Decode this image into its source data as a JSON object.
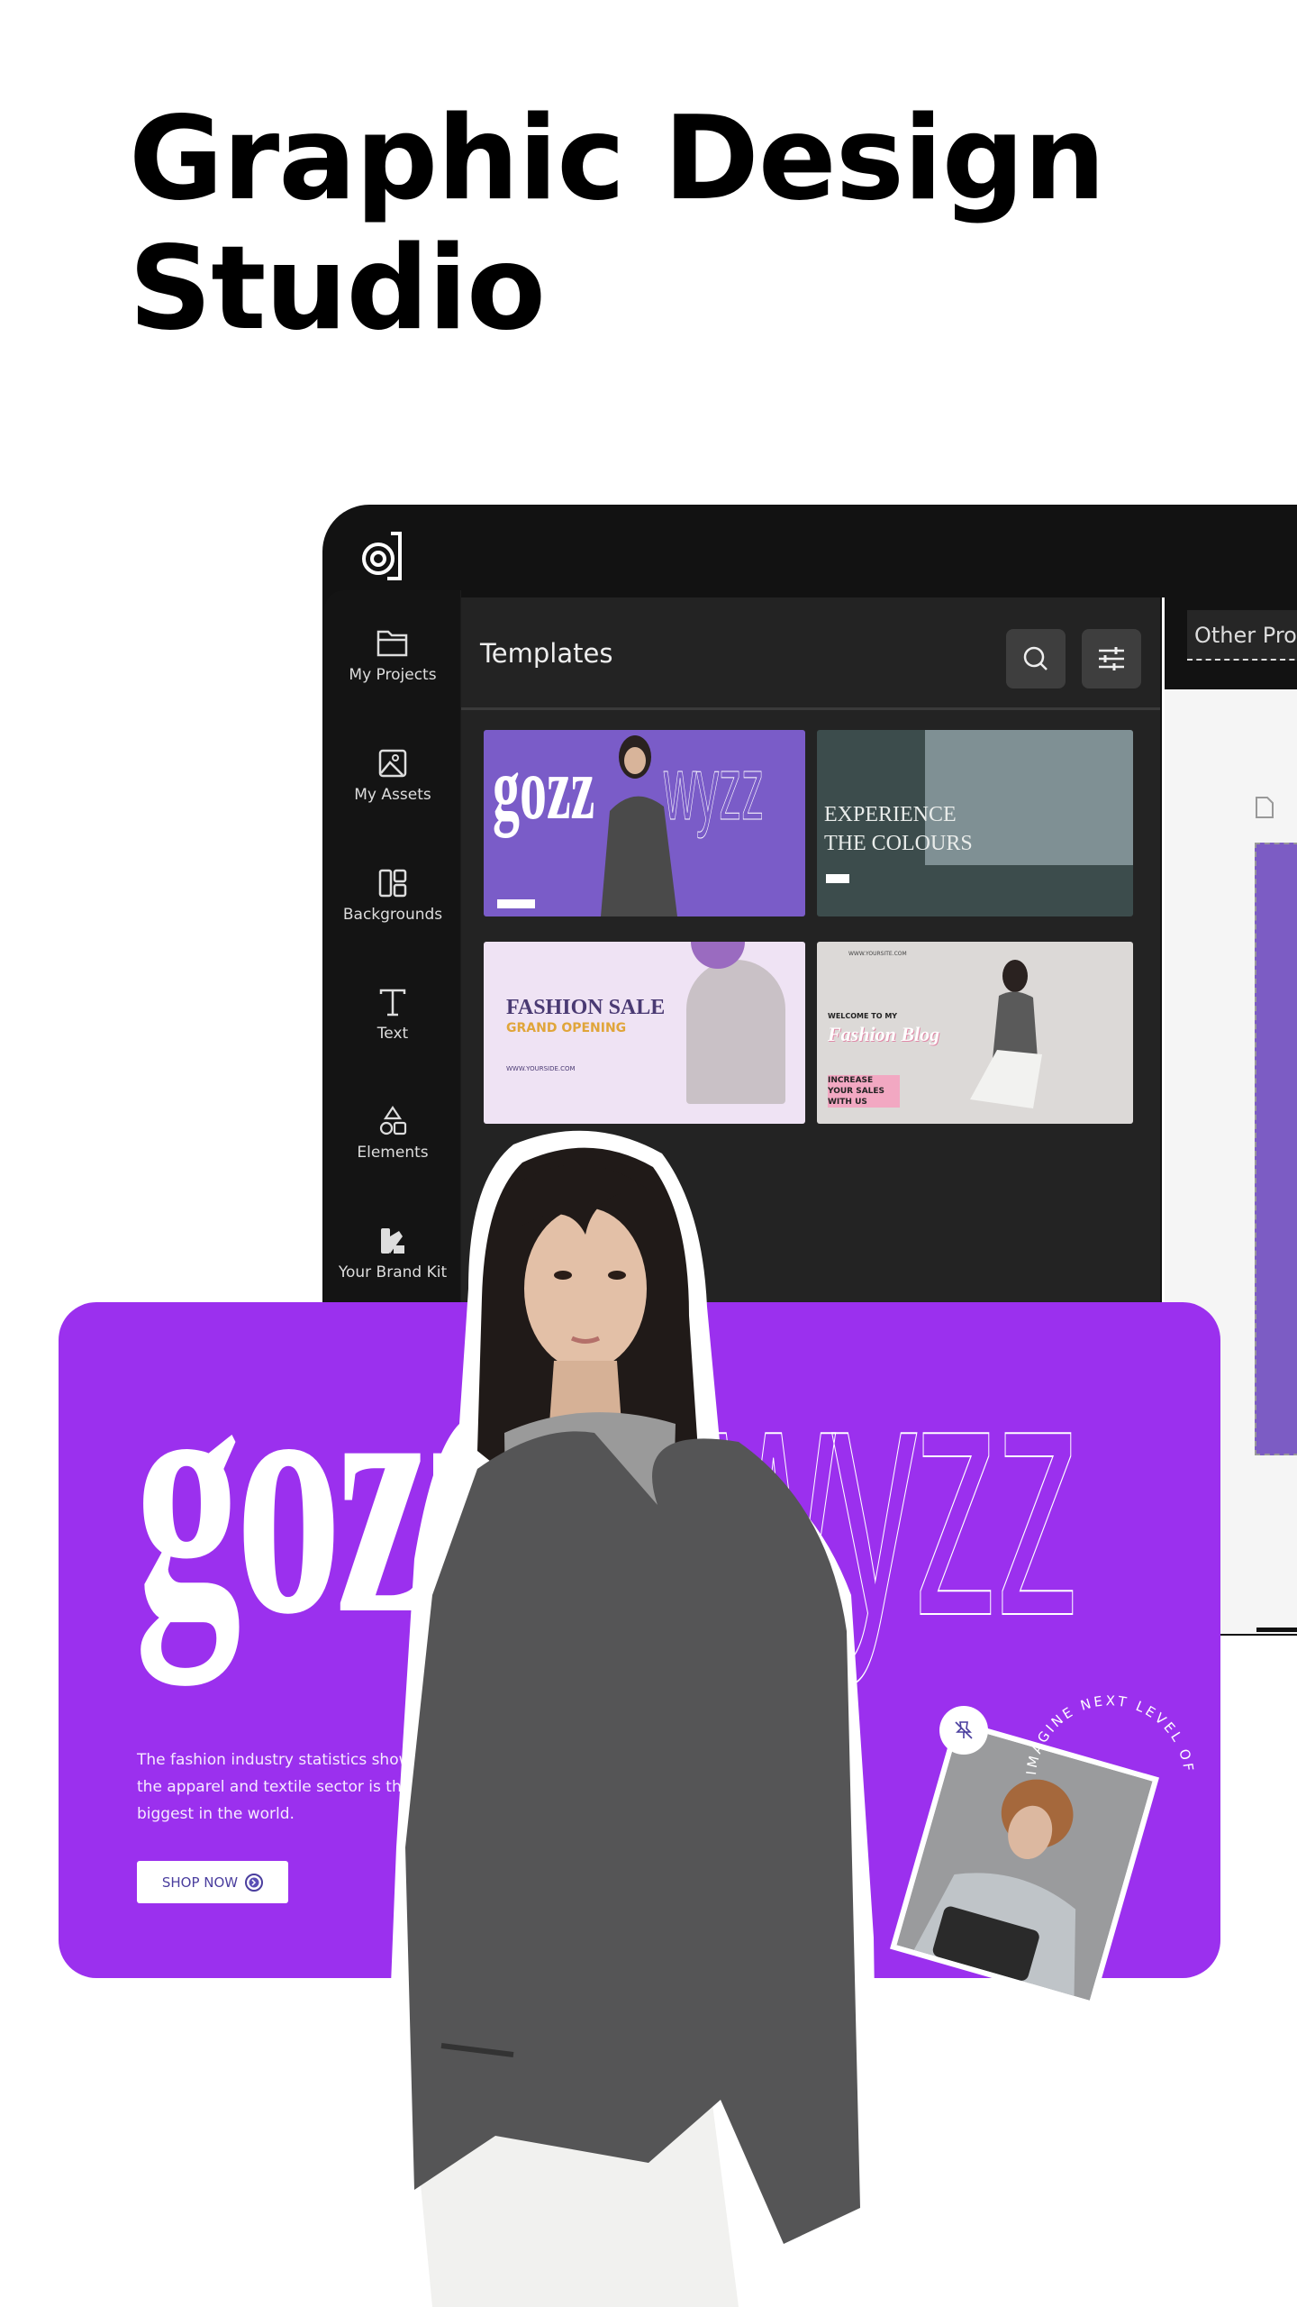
{
  "hero": {
    "title_line1": "Graphic Design",
    "title_line2": "Studio"
  },
  "sidebar": {
    "items": [
      {
        "label": "My Projects",
        "icon": "folder-icon"
      },
      {
        "label": "My Assets",
        "icon": "image-icon"
      },
      {
        "label": "Backgrounds",
        "icon": "layout-icon"
      },
      {
        "label": "Text",
        "icon": "text-icon"
      },
      {
        "label": "Elements",
        "icon": "shapes-icon"
      },
      {
        "label": "Your Brand Kit",
        "icon": "brand-kit-icon"
      }
    ]
  },
  "panel": {
    "title": "Templates",
    "search_icon": "search-icon",
    "filter_icon": "sliders-icon"
  },
  "templates": [
    {
      "word1": "gozz",
      "word2": "wyzz"
    },
    {
      "line1": "EXPERIENCE",
      "line2": "THE COLOURS"
    },
    {
      "title": "FASHION SALE",
      "subtitle": "GRAND OPENING",
      "url": "WWW.YOURSIDE.COM"
    },
    {
      "url": "WWW.YOURSITE.COM",
      "kicker": "WELCOME TO MY",
      "title": "Fashion Blog",
      "cta": "INCREASE YOUR SALES WITH US"
    }
  ],
  "right_panel": {
    "tab": "Other Prod"
  },
  "banner": {
    "word1": "gozz",
    "word2": "wyzz",
    "body": "The fashion industry statistics show that the apparel and textile sector is the 4th biggest in the world.",
    "cta": "SHOP NOW",
    "circular_text": "IMAGINE NEXT LEVEL OF",
    "pin_icon": "pin-off-icon"
  },
  "colors": {
    "accent": "#9b30ee",
    "app_bg": "#121212",
    "panel_bg": "#232323",
    "button_text": "#4a3e9e"
  }
}
